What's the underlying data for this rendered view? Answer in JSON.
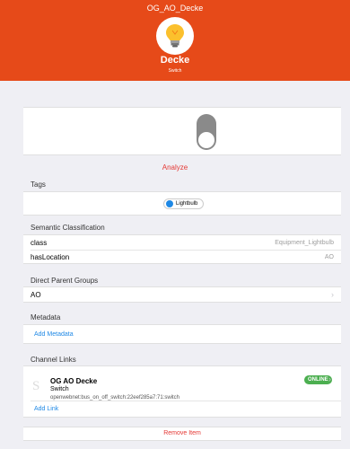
{
  "header": {
    "title": "OG_AO_Decke",
    "item_label": "Decke",
    "item_type": "Switch",
    "icon": "lightbulb-icon",
    "accent": "#e64a19"
  },
  "state": {
    "icon": "toggle-switch",
    "on": false
  },
  "analyze_label": "Analyze",
  "tags": {
    "title": "Tags",
    "items": [
      {
        "label": "Lightbulb",
        "icon": "tag-icon"
      }
    ]
  },
  "semantic": {
    "title": "Semantic Classification",
    "rows": [
      {
        "label": "class",
        "value": "Equipment_Lightbulb"
      },
      {
        "label": "hasLocation",
        "value": "AO"
      }
    ]
  },
  "groups": {
    "title": "Direct Parent Groups",
    "items": [
      {
        "label": "AO"
      }
    ]
  },
  "metadata": {
    "title": "Metadata",
    "add_label": "Add Metadata"
  },
  "channels": {
    "title": "Channel Links",
    "items": [
      {
        "initial": "S",
        "title": "OG AO Decke",
        "subtitle": "Switch",
        "uid": "openwebnet:bus_on_off_switch:22eef285a7:71:switch",
        "status": "ONLINE"
      }
    ],
    "add_label": "Add Link"
  },
  "remove_label": "Remove Item",
  "colors": {
    "link": "#1e88e5",
    "danger": "#e53935",
    "online": "#4caf50"
  }
}
